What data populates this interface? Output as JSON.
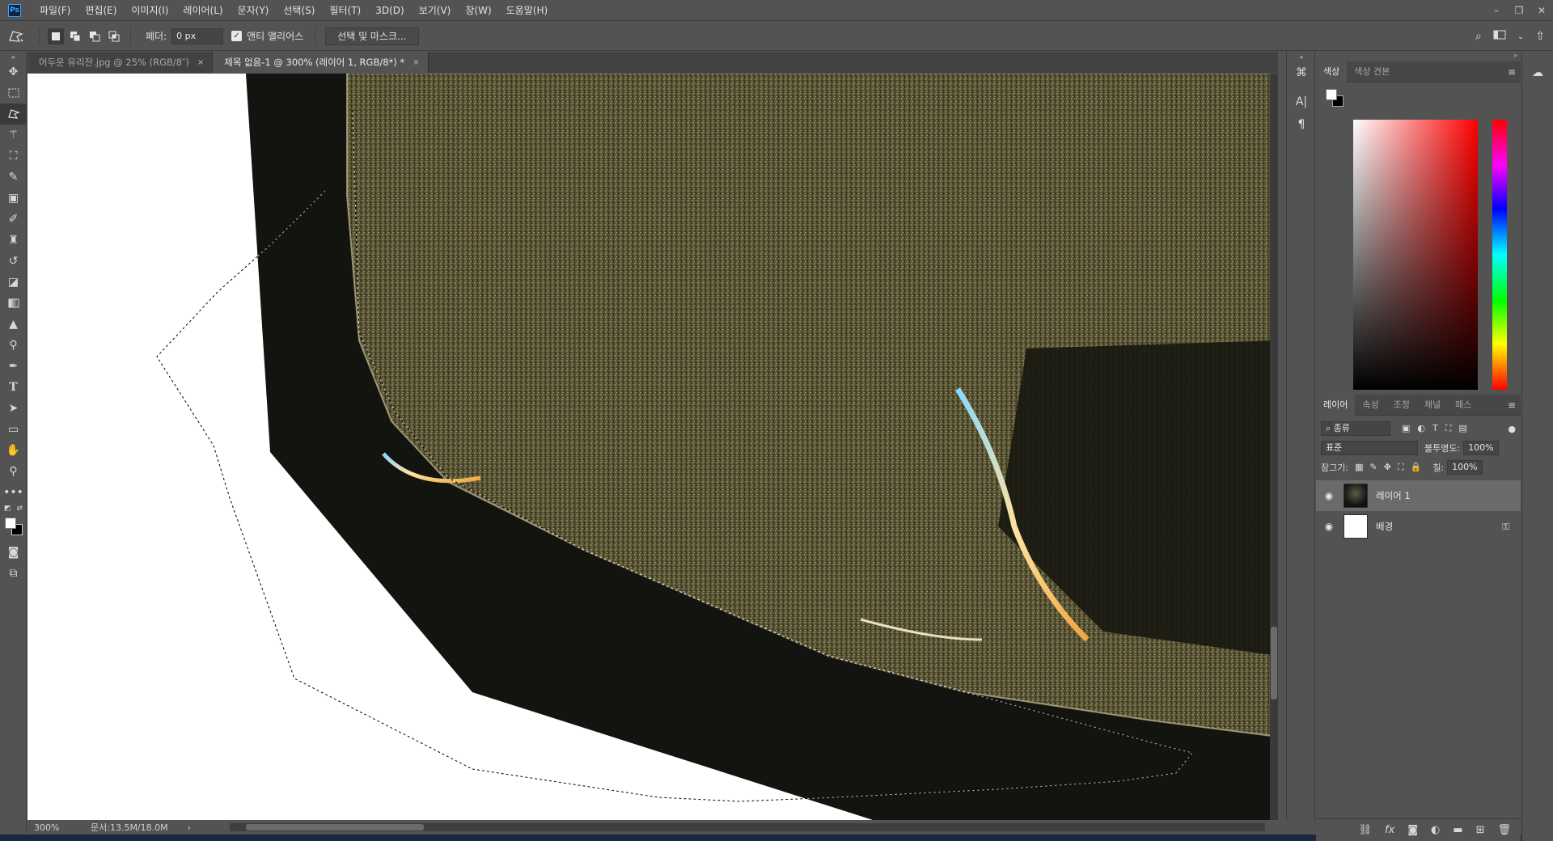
{
  "menubar": {
    "logo": "Ps",
    "items": [
      "파일(F)",
      "편집(E)",
      "이미지(I)",
      "레이어(L)",
      "문자(Y)",
      "선택(S)",
      "필터(T)",
      "3D(D)",
      "보기(V)",
      "창(W)",
      "도움말(H)"
    ]
  },
  "options": {
    "feather_label": "페더:",
    "feather_value": "0 px",
    "antialias_label": "앤티 앨리어스",
    "antialias_checked": true,
    "select_mask_label": "선택 및 마스크..."
  },
  "tabs": [
    {
      "label": "어두운 유리잔.jpg @ 25% (RGB/8″)",
      "active": false
    },
    {
      "label": "제목 없음-1 @ 300% (레이어 1, RGB/8*) *",
      "active": true
    }
  ],
  "status": {
    "zoom": "300%",
    "doc_info": "문서:13.5M/18.0M",
    "arrow": "›"
  },
  "color_panel": {
    "tabs": [
      "색상",
      "색상 견본"
    ],
    "foreground": "#ffffff",
    "background": "#000000"
  },
  "layers_panel": {
    "tabs": [
      "레이어",
      "속성",
      "조정",
      "채널",
      "패스"
    ],
    "filter_label": "종류",
    "blend_mode": "표준",
    "opacity_label": "불투명도:",
    "opacity_value": "100%",
    "lock_label": "잠그기:",
    "fill_label": "칠:",
    "fill_value": "100%",
    "layers": [
      {
        "name": "레이어 1",
        "selected": true,
        "locked": false
      },
      {
        "name": "배경",
        "selected": false,
        "locked": true
      }
    ]
  },
  "icons": {
    "window_minimize": "–",
    "window_restore": "❐",
    "window_close": "✕",
    "tab_close": "×",
    "eye": "◉",
    "lock": "⚿",
    "search": "⌕",
    "share": "⇧"
  },
  "footer_icons": [
    "link-icon",
    "fx-icon",
    "mask-icon",
    "adjustment-icon",
    "folder-icon",
    "new-layer-icon",
    "trash-icon"
  ]
}
